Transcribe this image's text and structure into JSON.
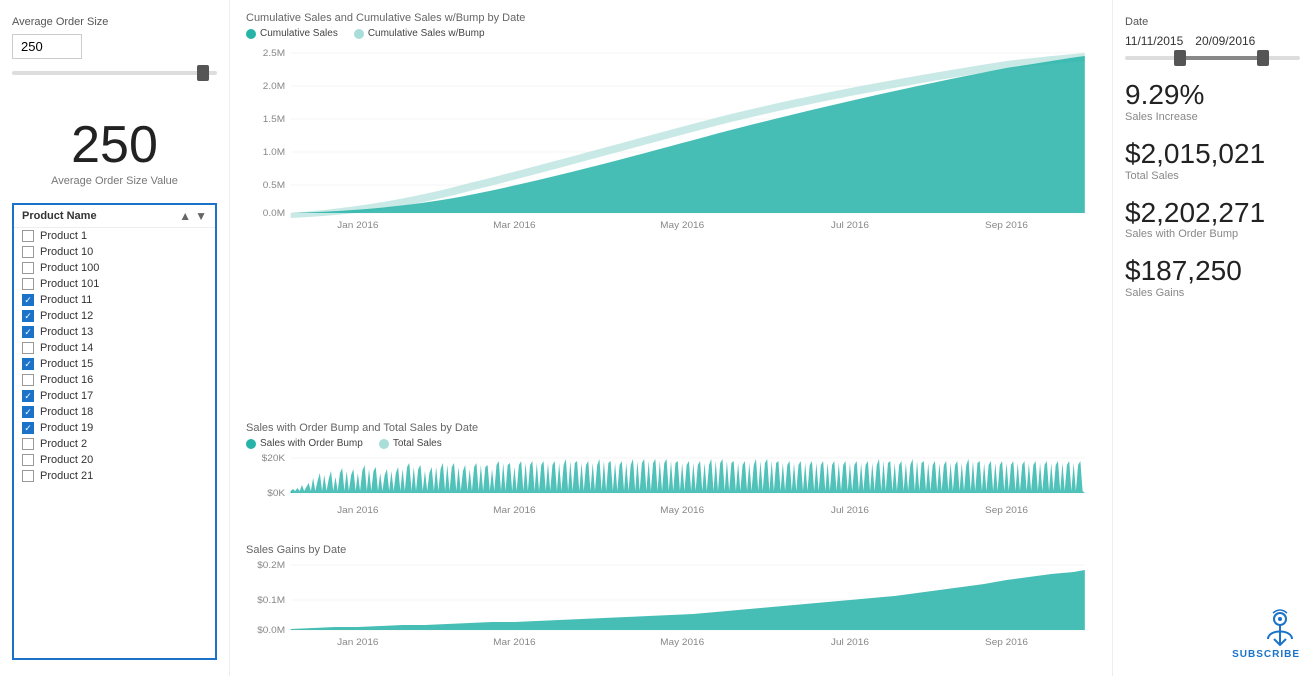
{
  "left": {
    "slider_label": "Average Order Size",
    "slider_value": "250",
    "big_number": "250",
    "big_number_label": "Average Order Size Value",
    "product_list_title": "Product Name",
    "products": [
      {
        "name": "Product 1",
        "checked": false
      },
      {
        "name": "Product 10",
        "checked": false
      },
      {
        "name": "Product 100",
        "checked": false
      },
      {
        "name": "Product 101",
        "checked": false
      },
      {
        "name": "Product 11",
        "checked": true
      },
      {
        "name": "Product 12",
        "checked": true
      },
      {
        "name": "Product 13",
        "checked": true
      },
      {
        "name": "Product 14",
        "checked": false
      },
      {
        "name": "Product 15",
        "checked": true
      },
      {
        "name": "Product 16",
        "checked": false
      },
      {
        "name": "Product 17",
        "checked": true
      },
      {
        "name": "Product 18",
        "checked": true
      },
      {
        "name": "Product 19",
        "checked": true
      },
      {
        "name": "Product 2",
        "checked": false
      },
      {
        "name": "Product 20",
        "checked": false
      },
      {
        "name": "Product 21",
        "checked": false
      }
    ]
  },
  "center": {
    "chart1_title": "Cumulative Sales and Cumulative Sales w/Bump by Date",
    "chart1_legend": [
      {
        "label": "Cumulative Sales",
        "color": "#26b3a8"
      },
      {
        "label": "Cumulative Sales w/Bump",
        "color": "#a8ddd9"
      }
    ],
    "chart1_y_labels": [
      "2.5M",
      "2.0M",
      "1.5M",
      "1.0M",
      "0.5M",
      "0.0M"
    ],
    "chart1_x_labels": [
      "Jan 2016",
      "Mar 2016",
      "May 2016",
      "Jul 2016",
      "Sep 2016"
    ],
    "chart2_title": "Sales with Order Bump and Total Sales by Date",
    "chart2_legend": [
      {
        "label": "Sales with Order Bump",
        "color": "#26b3a8"
      },
      {
        "label": "Total Sales",
        "color": "#a8ddd9"
      }
    ],
    "chart2_y_labels": [
      "$20K",
      "$0K"
    ],
    "chart2_x_labels": [
      "Jan 2016",
      "Mar 2016",
      "May 2016",
      "Jul 2016",
      "Sep 2016"
    ],
    "chart3_title": "Sales Gains by Date",
    "chart3_y_labels": [
      "$0.2M",
      "$0.1M",
      "$0.0M"
    ],
    "chart3_x_labels": [
      "Jan 2016",
      "Mar 2016",
      "May 2016",
      "Jul 2016",
      "Sep 2016"
    ]
  },
  "right": {
    "date_label": "Date",
    "date_start": "11/11/2015",
    "date_end": "20/09/2016",
    "metrics": [
      {
        "value": "9.29%",
        "label": "Sales Increase"
      },
      {
        "value": "$2,015,021",
        "label": "Total Sales"
      },
      {
        "value": "$2,202,271",
        "label": "Sales with Order Bump"
      },
      {
        "value": "$187,250",
        "label": "Sales Gains"
      }
    ],
    "subscribe_label": "SUBSCRIBE"
  }
}
